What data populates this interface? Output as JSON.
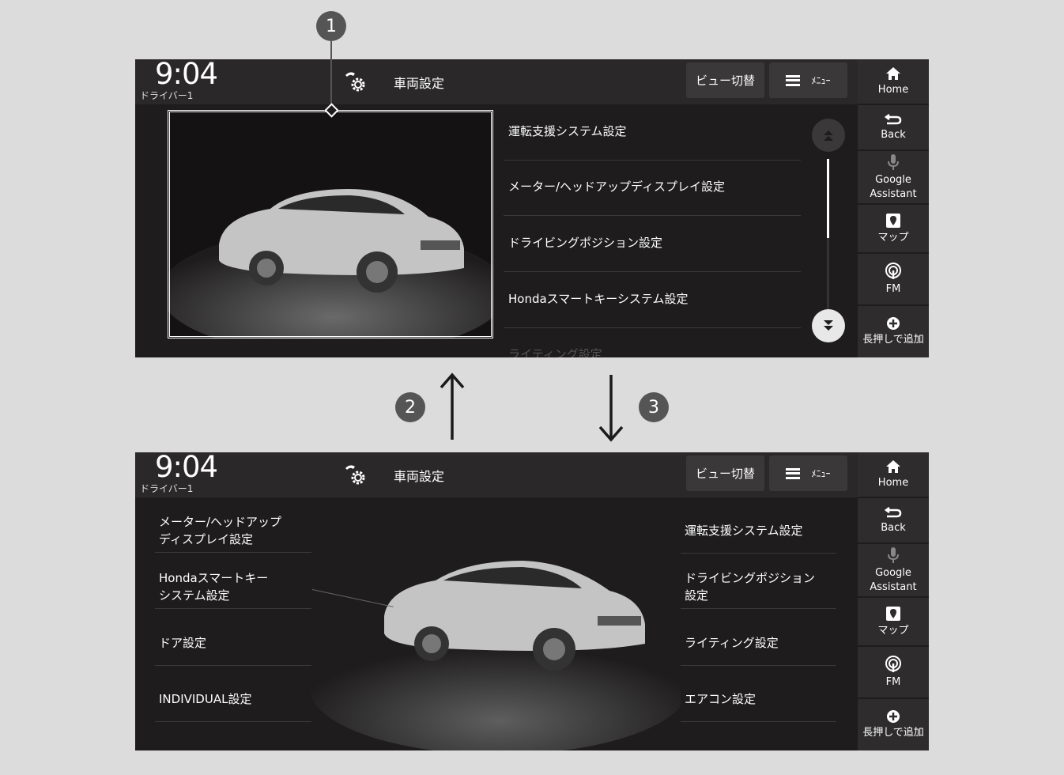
{
  "header": {
    "clock": "9:04",
    "driver": "ドライバー1",
    "title": "車両設定",
    "view_label": "ビュー切替",
    "menu_label": "ﾒﾆｭｰ"
  },
  "sidebar": [
    {
      "label": "Home",
      "icon": "home-icon"
    },
    {
      "label": "Back",
      "icon": "back-icon"
    },
    {
      "label": "Google Assistant",
      "icon": "mic-icon"
    },
    {
      "label": "マップ",
      "icon": "map-icon"
    },
    {
      "label": "FM",
      "icon": "radio-icon"
    },
    {
      "label": "長押しで追加",
      "icon": "add-icon"
    }
  ],
  "top_list": [
    "運転支援システム設定",
    "メーター/ヘッドアップディスプレイ設定",
    "ドライビングポジション設定",
    "Hondaスマートキーシステム設定",
    "ライティング設定"
  ],
  "bottom_left": [
    "メーター/ヘッドアップ\nディスプレイ設定",
    "Hondaスマートキー\nシステム設定",
    "ドア設定",
    "INDIVIDUAL設定"
  ],
  "bottom_right": [
    "運転支援システム設定",
    "ドライビングポジション\n設定",
    "ライティング設定",
    "エアコン設定"
  ],
  "callouts": [
    "1",
    "2",
    "3"
  ],
  "colors": {
    "screen_bg": "#1e1c1c",
    "header_bg": "#2a2828",
    "sidebar_bg": "#2e2c2c"
  }
}
